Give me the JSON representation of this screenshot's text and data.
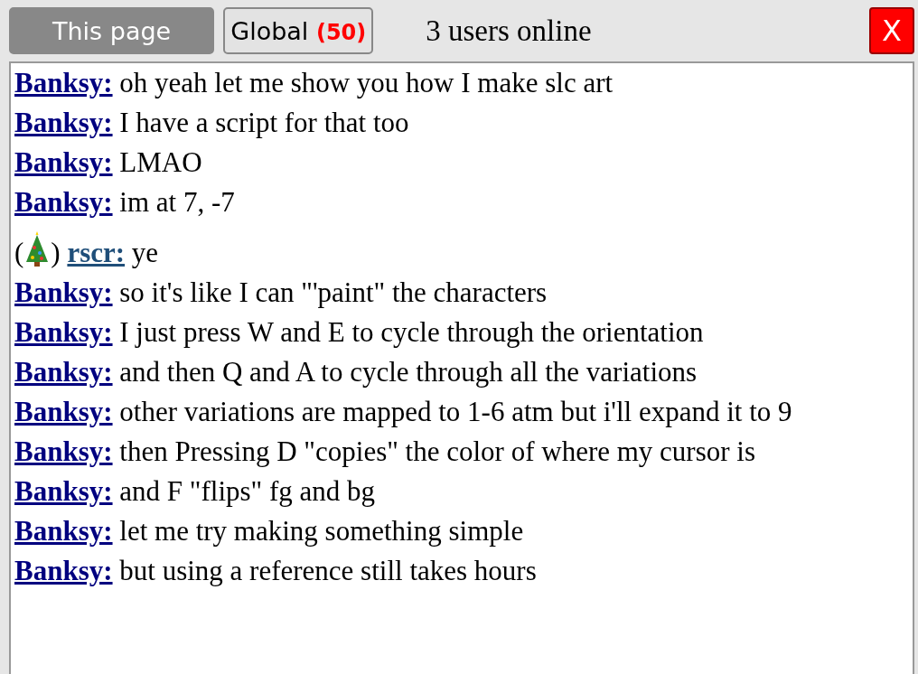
{
  "tabs": [
    {
      "label": "This page",
      "selected": true
    },
    {
      "label": "Global",
      "count": "(50)",
      "selected": false
    }
  ],
  "status": "3 users online",
  "close_button": "X",
  "messages": [
    {
      "kind": "plain",
      "author": "Banksy:",
      "color": "#00007f",
      "text": "oh yeah let me show you how I make slc art"
    },
    {
      "kind": "plain",
      "author": "Banksy:",
      "color": "#00007f",
      "text": "I have a script for that too"
    },
    {
      "kind": "plain",
      "author": "Banksy:",
      "color": "#00007f",
      "text": "LMAO"
    },
    {
      "kind": "plain",
      "author": "Banksy:",
      "color": "#00007f",
      "text": "im at 7, -7"
    },
    {
      "kind": "badged",
      "badge_open": "(",
      "badge_close": ")",
      "author": "rscr:",
      "color": "#1f4e79",
      "text": "ye"
    },
    {
      "kind": "plain",
      "author": "Banksy:",
      "color": "#00007f",
      "text": "so it's like I can \"'paint\" the characters"
    },
    {
      "kind": "plain",
      "author": "Banksy:",
      "color": "#00007f",
      "text": "I just press W and E to cycle through the orientation"
    },
    {
      "kind": "plain",
      "author": "Banksy:",
      "color": "#00007f",
      "text": "and then Q and A to cycle through all the variations"
    },
    {
      "kind": "plain",
      "author": "Banksy:",
      "color": "#00007f",
      "text": "other variations are mapped to 1-6 atm but i'll expand it to 9"
    },
    {
      "kind": "plain",
      "author": "Banksy:",
      "color": "#00007f",
      "text": "then Pressing D \"copies\" the color of where my cursor is"
    },
    {
      "kind": "plain",
      "author": "Banksy:",
      "color": "#00007f",
      "text": "and F \"flips\" fg and bg"
    },
    {
      "kind": "plain",
      "author": "Banksy:",
      "color": "#00007f",
      "text": "let me try making something simple"
    },
    {
      "kind": "plain",
      "author": "Banksy:",
      "color": "#00007f",
      "text": "but using a reference still takes hours"
    }
  ]
}
